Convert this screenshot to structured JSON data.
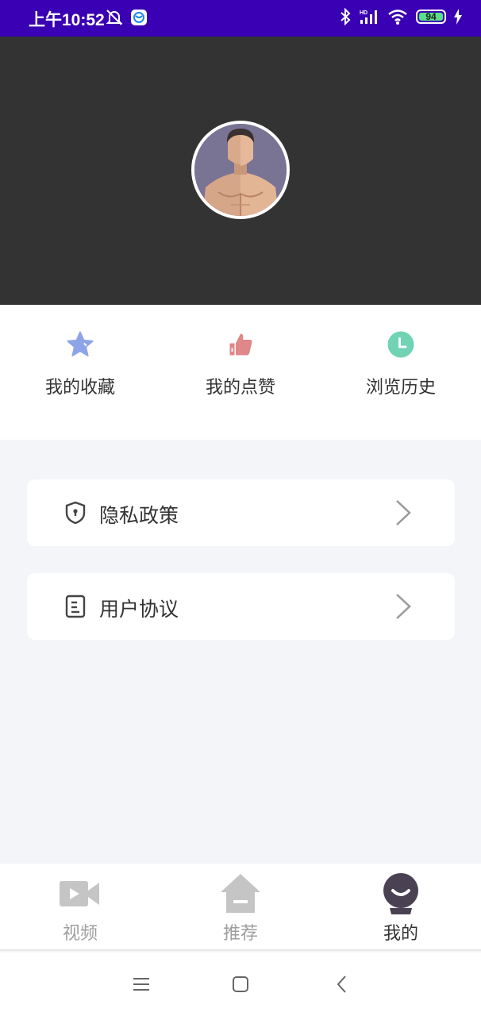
{
  "status_bar": {
    "time": "上午10:52",
    "battery": "94",
    "battery_level": 0.94,
    "icons": [
      "alarm-off-icon",
      "app-notification-icon",
      "bluetooth-icon",
      "hd-signal-icon",
      "wifi-icon",
      "battery-icon",
      "charging-icon"
    ]
  },
  "profile": {
    "avatar": "avatar"
  },
  "quick_actions": [
    {
      "label": "我的收藏",
      "icon": "star-icon",
      "color": "#8da4e8"
    },
    {
      "label": "我的点赞",
      "icon": "thumbs-up-icon",
      "color": "#e0878a"
    },
    {
      "label": "浏览历史",
      "icon": "clock-icon",
      "color": "#6fd3b4"
    }
  ],
  "menu": [
    {
      "label": "隐私政策",
      "icon": "shield-icon"
    },
    {
      "label": "用户协议",
      "icon": "document-icon"
    }
  ],
  "tabs": [
    {
      "label": "视频",
      "icon": "video-camera-icon",
      "active": false
    },
    {
      "label": "推荐",
      "icon": "home-icon",
      "active": false
    },
    {
      "label": "我的",
      "icon": "profile-icon",
      "active": true
    }
  ],
  "nav": {
    "icons": [
      "menu-icon",
      "home-square-icon",
      "back-icon"
    ]
  }
}
